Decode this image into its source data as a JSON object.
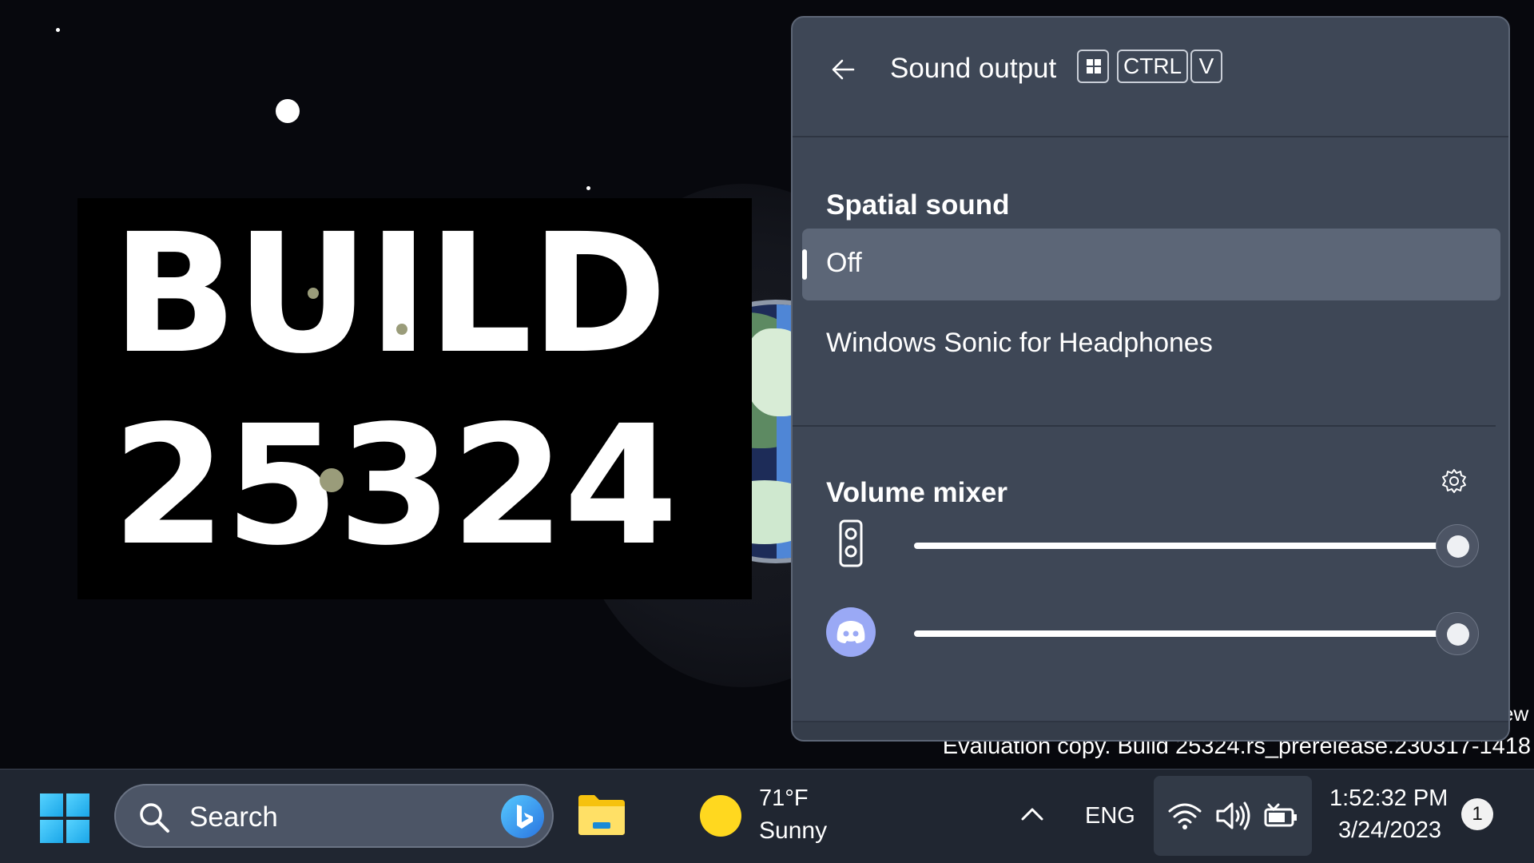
{
  "wallpaper": {
    "build_line1": "BUILD",
    "build_line2": "25324",
    "watermark_edge": "ew",
    "watermark": "Evaluation copy. Build 25324.rs_prerelease.230317-1418"
  },
  "flyout": {
    "title": "Sound output",
    "shortcut_keys": {
      "win": "windows-logo-key",
      "ctrl": "CTRL",
      "v": "V"
    },
    "spatial_sound": {
      "heading": "Spatial sound",
      "options": [
        {
          "label": "Off",
          "selected": true
        },
        {
          "label": "Windows Sonic for Headphones",
          "selected": false
        }
      ]
    },
    "volume_mixer": {
      "heading": "Volume mixer",
      "settings_icon": "gear-icon",
      "apps": [
        {
          "icon": "speaker-icon",
          "volume": 1.0
        },
        {
          "icon": "discord-icon",
          "volume": 1.0
        }
      ]
    }
  },
  "taskbar": {
    "start_icon": "windows-start-icon",
    "search": {
      "placeholder": "Search",
      "bing_icon": "bing-icon"
    },
    "pinned": [
      "file-explorer-icon"
    ],
    "weather": {
      "temp": "71°F",
      "condition": "Sunny",
      "icon": "sun-icon"
    },
    "tray": {
      "chevron": "chevron-up-icon",
      "language": "ENG",
      "icons": [
        "wifi-icon",
        "volume-icon",
        "battery-icon"
      ]
    },
    "clock": {
      "time": "1:52:32 PM",
      "date": "3/24/2023"
    },
    "notifications": "1"
  },
  "colors": {
    "flyout_bg": "#3e4756",
    "selected_bg": "#5c6677",
    "taskbar_bg": "#202631",
    "accent_blue": "#57d3ff",
    "weather_sun": "#ffd81f"
  }
}
